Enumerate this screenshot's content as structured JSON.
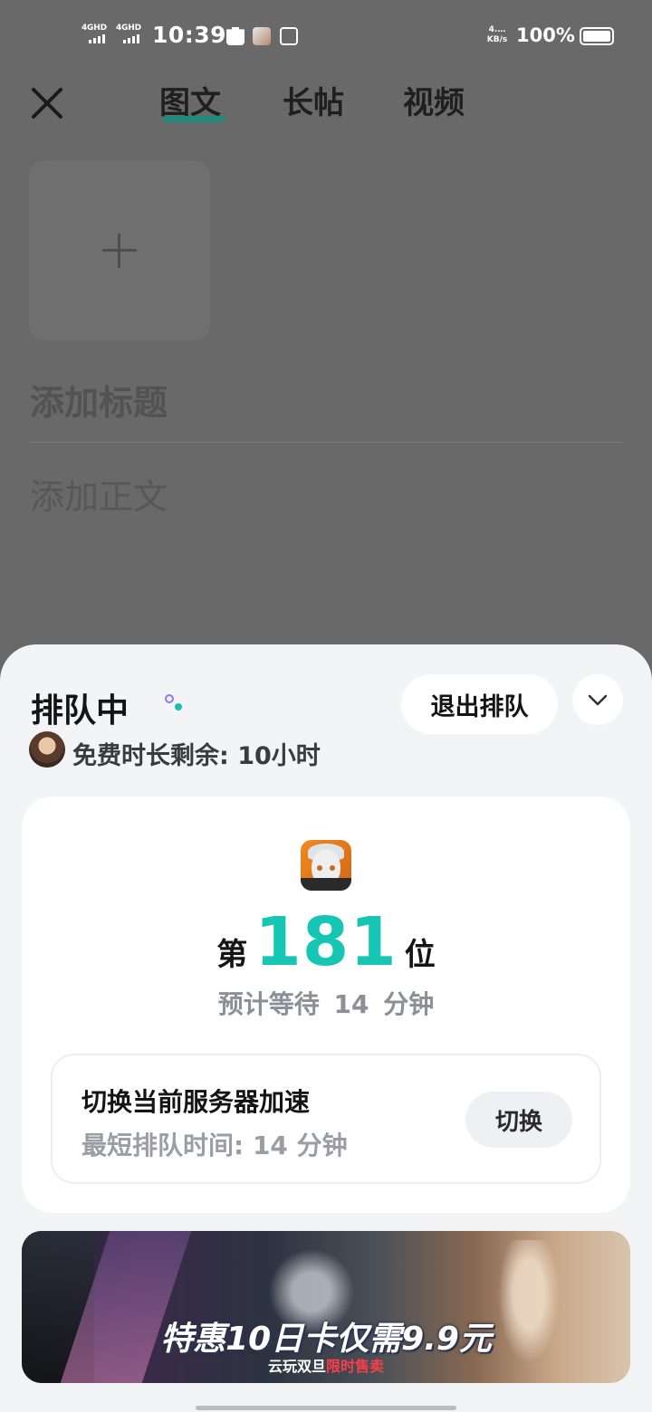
{
  "status_bar": {
    "signal1": "4GHD",
    "signal2": "4GHD",
    "time": "10:39",
    "net_speed_value": "4.…",
    "net_speed_unit": "KB/s",
    "battery": "100%"
  },
  "editor": {
    "tabs": [
      "图文",
      "长帖",
      "视频"
    ],
    "active_tab": "图文",
    "title_placeholder": "添加标题",
    "body_placeholder": "添加正文"
  },
  "queue": {
    "title": "排队中",
    "exit_label": "退出排队",
    "free_time": "免费时长剩余: 10小时",
    "rank_prefix": "第",
    "rank_number": "181",
    "rank_suffix": "位",
    "eta": "预计等待 14 分钟",
    "server_title": "切换当前服务器加速",
    "server_min_wait": "最短排队时间: 14 分钟",
    "switch_label": "切换"
  },
  "banner": {
    "headline": "特惠10日卡仅需9.9元",
    "sub_white": "云玩双旦",
    "sub_red": "限时售卖"
  },
  "colors": {
    "accent": "#16c6b4",
    "tab_underline": "#1d8c7a",
    "overlay": "#696969",
    "sheet_bg": "#f2f4f6"
  }
}
